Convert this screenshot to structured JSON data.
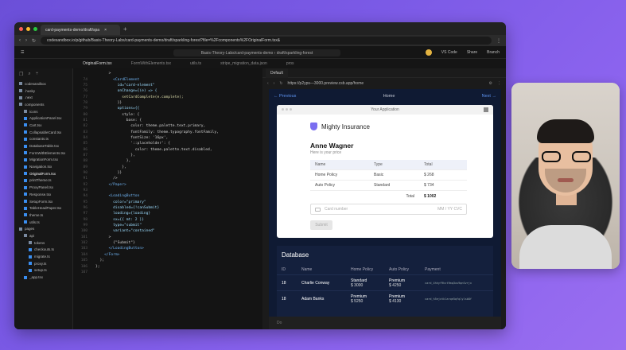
{
  "browser": {
    "tab_title": "card-payments-demo/draft/spa",
    "url": "codesandbox.io/p/github/Basis-Theory-Labs/card-payments-demo/draft/sparkling-forest?file=%2Fcomponents%2FOriginalForm.tsx&"
  },
  "topbar": {
    "repo": "Basis-Theory-Labs/card-payments-demo",
    "branch_path": "draft/sparkling-forest",
    "vscode_label": "VS Code",
    "share_label": "Share",
    "branch_label": "Branch"
  },
  "file_tabs": [
    "OriginalForm.tsx",
    "FormWithElements.tsx",
    "utils.ts",
    "stripe_migration_data.json",
    "pros"
  ],
  "preview_tab": "Default",
  "sidebar": {
    "items": [
      {
        "label": "codesandbox",
        "indent": 0,
        "kind": "folder"
      },
      {
        "label": ".husky",
        "indent": 0,
        "kind": "folder"
      },
      {
        "label": ".next",
        "indent": 0,
        "kind": "folder"
      },
      {
        "label": "components",
        "indent": 0,
        "kind": "folder"
      },
      {
        "label": "icons",
        "indent": 1,
        "kind": "folder"
      },
      {
        "label": "ApplicationPanel.tsx",
        "indent": 1,
        "kind": "file"
      },
      {
        "label": "Cart.tsx",
        "indent": 1,
        "kind": "file"
      },
      {
        "label": "CollapsableCard.tsx",
        "indent": 1,
        "kind": "file"
      },
      {
        "label": "constants.ts",
        "indent": 1,
        "kind": "file"
      },
      {
        "label": "DatabaseTable.tsx",
        "indent": 1,
        "kind": "file"
      },
      {
        "label": "FormWithElements.tsx",
        "indent": 1,
        "kind": "file"
      },
      {
        "label": "MigrationForm.tsx",
        "indent": 1,
        "kind": "file"
      },
      {
        "label": "Navigation.tsx",
        "indent": 1,
        "kind": "file"
      },
      {
        "label": "OriginalForm.tsx",
        "indent": 1,
        "kind": "file",
        "active": true
      },
      {
        "label": "printTheme.ts",
        "indent": 1,
        "kind": "file"
      },
      {
        "label": "ProxyPanel.tsx",
        "indent": 1,
        "kind": "file"
      },
      {
        "label": "Response.tsx",
        "indent": 1,
        "kind": "file"
      },
      {
        "label": "SetupForm.tsx",
        "indent": 1,
        "kind": "file"
      },
      {
        "label": "TableHeadPaper.tsx",
        "indent": 1,
        "kind": "file"
      },
      {
        "label": "theme.ts",
        "indent": 1,
        "kind": "file"
      },
      {
        "label": "utils.ts",
        "indent": 1,
        "kind": "file"
      },
      {
        "label": "pages",
        "indent": 0,
        "kind": "folder"
      },
      {
        "label": "api",
        "indent": 1,
        "kind": "folder"
      },
      {
        "label": "tokens",
        "indent": 2,
        "kind": "folder"
      },
      {
        "label": "checkouts.ts",
        "indent": 2,
        "kind": "file"
      },
      {
        "label": "migrate.ts",
        "indent": 2,
        "kind": "file"
      },
      {
        "label": "proxy.ts",
        "indent": 2,
        "kind": "file"
      },
      {
        "label": "setup.ts",
        "indent": 2,
        "kind": "file"
      },
      {
        "label": "_app.tsx",
        "indent": 1,
        "kind": "file"
      }
    ]
  },
  "editor": {
    "lines": [
      {
        "n": "",
        "code": "      >"
      },
      {
        "n": "74",
        "code": "        <CardElement"
      },
      {
        "n": "75",
        "code": "          id=\"card-element\""
      },
      {
        "n": "76",
        "code": "          onChange={(e) => {"
      },
      {
        "n": "77",
        "code": "            setCardComplete(e.complete);"
      },
      {
        "n": "78",
        "code": "          }}"
      },
      {
        "n": "79",
        "code": "          options={{"
      },
      {
        "n": "80",
        "code": "            style: {"
      },
      {
        "n": "81",
        "code": "              base: {"
      },
      {
        "n": "82",
        "code": "                color: theme.palette.text.primary,"
      },
      {
        "n": "83",
        "code": "                fontFamily: theme.typography.fontFamily,"
      },
      {
        "n": "84",
        "code": "                fontSize: '16px',"
      },
      {
        "n": "85",
        "code": "                '::placeholder': {"
      },
      {
        "n": "86",
        "code": "                  color: theme.palette.text.disabled,"
      },
      {
        "n": "87",
        "code": "                },"
      },
      {
        "n": "88",
        "code": "              },"
      },
      {
        "n": "89",
        "code": "            },"
      },
      {
        "n": "90",
        "code": "          }}"
      },
      {
        "n": "91",
        "code": "        />"
      },
      {
        "n": "92",
        "code": "      </Paper>"
      },
      {
        "n": "93",
        "code": ""
      },
      {
        "n": "94",
        "code": "      <LoadingButton"
      },
      {
        "n": "95",
        "code": "        color=\"primary\""
      },
      {
        "n": "96",
        "code": "        disabled={!canSubmit}"
      },
      {
        "n": "97",
        "code": "        loading={loading}"
      },
      {
        "n": "98",
        "code": "        sx={{ mt: 2 }}"
      },
      {
        "n": "99",
        "code": "        type=\"submit\""
      },
      {
        "n": "100",
        "code": "        variant=\"contained\""
      },
      {
        "n": "101",
        "code": "      >"
      },
      {
        "n": "102",
        "code": "        {\"Submit\"}"
      },
      {
        "n": "103",
        "code": "      </LoadingButton>"
      },
      {
        "n": "104",
        "code": "    </Form>"
      },
      {
        "n": "105",
        "code": "  );"
      },
      {
        "n": "106",
        "code": "};"
      },
      {
        "n": "107",
        "code": ""
      }
    ]
  },
  "preview": {
    "url": "https://p2yps—3000.preview.csb.app/home",
    "nav": {
      "prev": "Previous",
      "home": "Home",
      "next": "Next"
    },
    "app_title": "Your Application",
    "brand": "Mighty Insurance",
    "customer_name": "Anne Wagner",
    "subtitle": "Here is your price",
    "table": {
      "headers": [
        "Name",
        "Type",
        "Total"
      ],
      "rows": [
        [
          "Home Policy",
          "Basic",
          "$ 268"
        ],
        [
          "Auto Policy",
          "Standard",
          "$ 734"
        ]
      ],
      "total_label": "Total",
      "total_value": "$ 1002"
    },
    "card_placeholder": "Card number",
    "card_right": "MM / YY  CVC",
    "submit_label": "Submit",
    "footer": "Do"
  },
  "database": {
    "title": "Database",
    "headers": [
      "ID",
      "Name",
      "Home Policy",
      "Auto Policy",
      "Payment"
    ],
    "rows": [
      {
        "id": "18",
        "name": "Charlie Conway",
        "home_type": "Standard",
        "home_price": "$ 3000",
        "auto_type": "Premium",
        "auto_price": "$ 4250",
        "payment": "card_4hhyf9hzt9mq3us9qnSvrjx"
      },
      {
        "id": "18",
        "name": "Adam Banks",
        "home_type": "Premium",
        "home_price": "$ 5250",
        "auto_type": "Premium",
        "auto_price": "$ 4130",
        "payment": "card_h5ejxtklarqe5qfqlylsb8f"
      }
    ]
  }
}
